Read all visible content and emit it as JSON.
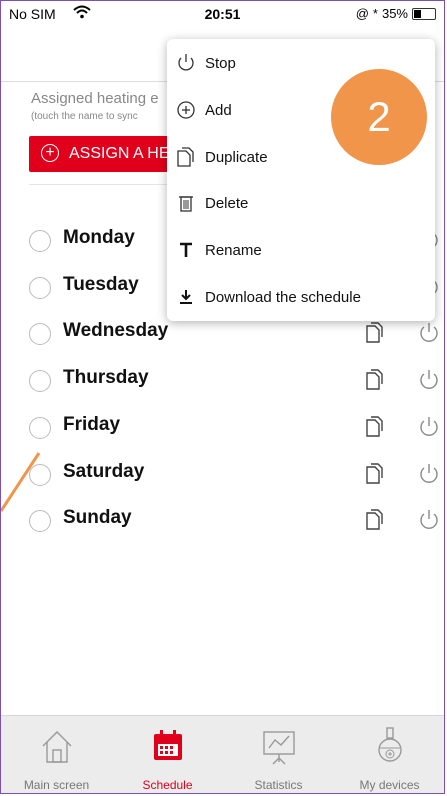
{
  "status_bar": {
    "carrier": "No SIM",
    "time": "20:51",
    "battery": "35%",
    "battery_level": 0.35
  },
  "assigned": {
    "label": "Assigned heating e",
    "hint": "(touch the name to sync"
  },
  "assign_button": {
    "label": "ASSIGN A HE"
  },
  "days": [
    "Monday",
    "Tuesday",
    "Wednesday",
    "Thursday",
    "Friday",
    "Saturday",
    "Sunday"
  ],
  "menu": {
    "items": [
      {
        "label": "Stop",
        "icon": "power-icon"
      },
      {
        "label": "Add",
        "icon": "plus-circle-icon"
      },
      {
        "label": "Duplicate",
        "icon": "duplicate-icon"
      },
      {
        "label": "Delete",
        "icon": "trash-icon"
      },
      {
        "label": "Rename",
        "icon": "text-icon"
      },
      {
        "label": "Download the schedule",
        "icon": "download-icon"
      }
    ]
  },
  "annotation": {
    "number": "2"
  },
  "tabs": [
    {
      "label": "Main screen",
      "icon": "home-icon"
    },
    {
      "label": "Schedule",
      "icon": "calendar-icon"
    },
    {
      "label": "Statistics",
      "icon": "chart-icon"
    },
    {
      "label": "My devices",
      "icon": "device-icon"
    }
  ],
  "colors": {
    "accent": "#e0001b",
    "annotation": "#f0954a",
    "frame": "#7b4fb3"
  }
}
